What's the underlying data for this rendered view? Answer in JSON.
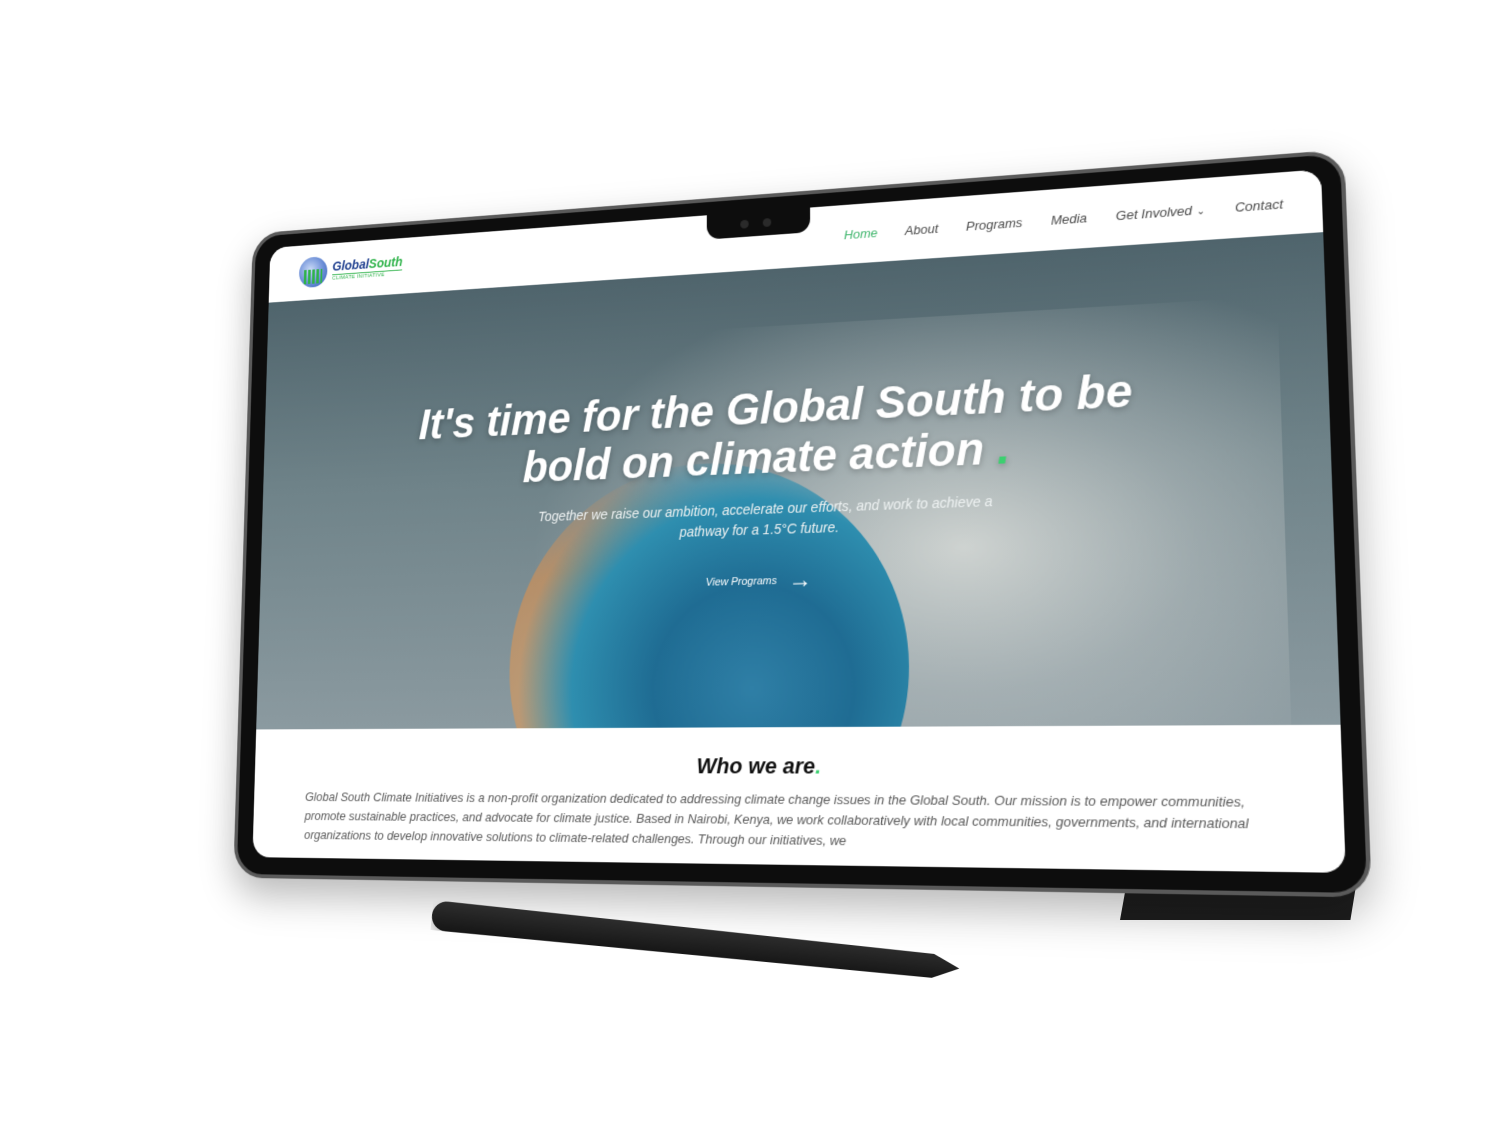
{
  "brand": {
    "name_part1": "Global",
    "name_part2": "South",
    "tagline": "CLIMATE INITIATIVE"
  },
  "nav": {
    "items": [
      {
        "label": "Home",
        "active": true
      },
      {
        "label": "About",
        "active": false
      },
      {
        "label": "Programs",
        "active": false
      },
      {
        "label": "Media",
        "active": false
      },
      {
        "label": "Get Involved",
        "active": false,
        "has_dropdown": true
      },
      {
        "label": "Contact",
        "active": false
      }
    ]
  },
  "hero": {
    "title": "It's time for the Global South to be bold on climate action",
    "title_dot": ".",
    "subtitle": "Together we raise our ambition, accelerate our efforts, and work to achieve a pathway for a 1.5°C future.",
    "cta_label": "View Programs",
    "cta_icon": "arrow-right-icon"
  },
  "about": {
    "title": "Who we are",
    "title_dot": ".",
    "text": "Global South Climate Initiatives is a non-profit organization dedicated to addressing climate change issues in the Global South. Our mission is to empower communities, promote sustainable practices, and advocate for climate justice. Based in Nairobi, Kenya, we work collaboratively with local communities, governments, and international organizations to develop innovative solutions to climate-related challenges. Through our initiatives, we"
  },
  "colors": {
    "accent_green": "#3cb46a",
    "dot_green": "#3cd070",
    "brand_blue": "#1f3f8f"
  }
}
